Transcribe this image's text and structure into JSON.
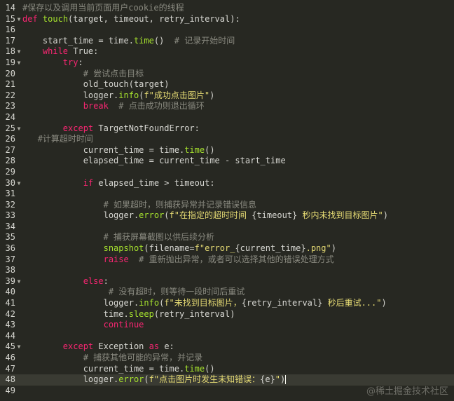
{
  "editor": {
    "lines": [
      {
        "num": "14",
        "fold": "",
        "current": false,
        "tokens": [
          {
            "t": "#保存以及调用当前页面用户cookie的线程",
            "c": "cm"
          }
        ]
      },
      {
        "num": "15",
        "fold": "▼",
        "current": false,
        "tokens": [
          {
            "t": "def",
            "c": "kw"
          },
          {
            "t": " ",
            "c": "pl"
          },
          {
            "t": "touch",
            "c": "fn"
          },
          {
            "t": "(target, timeout, retry_interval):",
            "c": "pl"
          }
        ]
      },
      {
        "num": "16",
        "fold": "",
        "current": false,
        "tokens": []
      },
      {
        "num": "17",
        "fold": "",
        "current": false,
        "tokens": [
          {
            "t": "    start_time = time.",
            "c": "pl"
          },
          {
            "t": "time",
            "c": "fn"
          },
          {
            "t": "()  ",
            "c": "pl"
          },
          {
            "t": "# 记录开始时间",
            "c": "cm"
          }
        ]
      },
      {
        "num": "18",
        "fold": "▼",
        "current": false,
        "tokens": [
          {
            "t": "    ",
            "c": "pl"
          },
          {
            "t": "while",
            "c": "kw"
          },
          {
            "t": " True:",
            "c": "pl"
          }
        ]
      },
      {
        "num": "19",
        "fold": "▼",
        "current": false,
        "tokens": [
          {
            "t": "        ",
            "c": "pl"
          },
          {
            "t": "try",
            "c": "kw"
          },
          {
            "t": ":",
            "c": "pl"
          }
        ]
      },
      {
        "num": "20",
        "fold": "",
        "current": false,
        "tokens": [
          {
            "t": "            ",
            "c": "pl"
          },
          {
            "t": "# 尝试点击目标",
            "c": "cm"
          }
        ]
      },
      {
        "num": "21",
        "fold": "",
        "current": false,
        "tokens": [
          {
            "t": "            old_touch(target)",
            "c": "pl"
          }
        ]
      },
      {
        "num": "22",
        "fold": "",
        "current": false,
        "tokens": [
          {
            "t": "            logger.",
            "c": "pl"
          },
          {
            "t": "info",
            "c": "fn"
          },
          {
            "t": "(",
            "c": "pl"
          },
          {
            "t": "f\"成功点击图片\"",
            "c": "str"
          },
          {
            "t": ")",
            "c": "pl"
          }
        ]
      },
      {
        "num": "23",
        "fold": "",
        "current": false,
        "tokens": [
          {
            "t": "            ",
            "c": "pl"
          },
          {
            "t": "break",
            "c": "kw"
          },
          {
            "t": "  ",
            "c": "pl"
          },
          {
            "t": "# 点击成功则退出循环",
            "c": "cm"
          }
        ]
      },
      {
        "num": "24",
        "fold": "",
        "current": false,
        "tokens": []
      },
      {
        "num": "25",
        "fold": "▼",
        "current": false,
        "tokens": [
          {
            "t": "        ",
            "c": "pl"
          },
          {
            "t": "except",
            "c": "kw"
          },
          {
            "t": " TargetNotFoundError:",
            "c": "pl"
          }
        ]
      },
      {
        "num": "26",
        "fold": "",
        "current": false,
        "tokens": [
          {
            "t": "   ",
            "c": "pl"
          },
          {
            "t": "#计算超时时间",
            "c": "cm"
          }
        ]
      },
      {
        "num": "27",
        "fold": "",
        "current": false,
        "tokens": [
          {
            "t": "            current_time = time.",
            "c": "pl"
          },
          {
            "t": "time",
            "c": "fn"
          },
          {
            "t": "()",
            "c": "pl"
          }
        ]
      },
      {
        "num": "28",
        "fold": "",
        "current": false,
        "tokens": [
          {
            "t": "            elapsed_time = current_time - start_time",
            "c": "pl"
          }
        ]
      },
      {
        "num": "29",
        "fold": "",
        "current": false,
        "tokens": []
      },
      {
        "num": "30",
        "fold": "▼",
        "current": false,
        "tokens": [
          {
            "t": "            ",
            "c": "pl"
          },
          {
            "t": "if",
            "c": "kw"
          },
          {
            "t": " elapsed_time > timeout:",
            "c": "pl"
          }
        ]
      },
      {
        "num": "31",
        "fold": "",
        "current": false,
        "tokens": []
      },
      {
        "num": "32",
        "fold": "",
        "current": false,
        "tokens": [
          {
            "t": "                ",
            "c": "pl"
          },
          {
            "t": "# 如果超时，则捕获异常并记录错误信息",
            "c": "cm"
          }
        ]
      },
      {
        "num": "33",
        "fold": "",
        "current": false,
        "tokens": [
          {
            "t": "                logger.",
            "c": "pl"
          },
          {
            "t": "error",
            "c": "fn"
          },
          {
            "t": "(",
            "c": "pl"
          },
          {
            "t": "f\"在指定的超时时间 ",
            "c": "str"
          },
          {
            "t": "{timeout}",
            "c": "pl"
          },
          {
            "t": " 秒内未找到目标图片\"",
            "c": "str"
          },
          {
            "t": ")",
            "c": "pl"
          }
        ]
      },
      {
        "num": "34",
        "fold": "",
        "current": false,
        "tokens": []
      },
      {
        "num": "35",
        "fold": "",
        "current": false,
        "tokens": [
          {
            "t": "                ",
            "c": "pl"
          },
          {
            "t": "# 捕获屏幕截图以供后续分析",
            "c": "cm"
          }
        ]
      },
      {
        "num": "36",
        "fold": "",
        "current": false,
        "tokens": [
          {
            "t": "                ",
            "c": "pl"
          },
          {
            "t": "snapshot",
            "c": "fn"
          },
          {
            "t": "(filename=",
            "c": "pl"
          },
          {
            "t": "f\"error_",
            "c": "str"
          },
          {
            "t": "{current_time}",
            "c": "pl"
          },
          {
            "t": ".png\"",
            "c": "str"
          },
          {
            "t": ")",
            "c": "pl"
          }
        ]
      },
      {
        "num": "37",
        "fold": "",
        "current": false,
        "tokens": [
          {
            "t": "                ",
            "c": "pl"
          },
          {
            "t": "raise",
            "c": "kw"
          },
          {
            "t": "  ",
            "c": "pl"
          },
          {
            "t": "# 重新抛出异常，或者可以选择其他的错误处理方式",
            "c": "cm"
          }
        ]
      },
      {
        "num": "38",
        "fold": "",
        "current": false,
        "tokens": []
      },
      {
        "num": "39",
        "fold": "▼",
        "current": false,
        "tokens": [
          {
            "t": "            ",
            "c": "pl"
          },
          {
            "t": "else",
            "c": "kw"
          },
          {
            "t": ":",
            "c": "pl"
          }
        ]
      },
      {
        "num": "40",
        "fold": "",
        "current": false,
        "tokens": [
          {
            "t": "                 ",
            "c": "pl"
          },
          {
            "t": "# 没有超时，则等待一段时间后重试",
            "c": "cm"
          }
        ]
      },
      {
        "num": "41",
        "fold": "",
        "current": false,
        "tokens": [
          {
            "t": "                logger.",
            "c": "pl"
          },
          {
            "t": "info",
            "c": "fn"
          },
          {
            "t": "(",
            "c": "pl"
          },
          {
            "t": "f\"未找到目标图片，",
            "c": "str"
          },
          {
            "t": "{retry_interval}",
            "c": "pl"
          },
          {
            "t": " 秒后重试...\"",
            "c": "str"
          },
          {
            "t": ")",
            "c": "pl"
          }
        ]
      },
      {
        "num": "42",
        "fold": "",
        "current": false,
        "tokens": [
          {
            "t": "                time.",
            "c": "pl"
          },
          {
            "t": "sleep",
            "c": "fn"
          },
          {
            "t": "(retry_interval)",
            "c": "pl"
          }
        ]
      },
      {
        "num": "43",
        "fold": "",
        "current": false,
        "tokens": [
          {
            "t": "                ",
            "c": "pl"
          },
          {
            "t": "continue",
            "c": "kw"
          }
        ]
      },
      {
        "num": "44",
        "fold": "",
        "current": false,
        "tokens": []
      },
      {
        "num": "45",
        "fold": "▼",
        "current": false,
        "tokens": [
          {
            "t": "        ",
            "c": "pl"
          },
          {
            "t": "except",
            "c": "kw"
          },
          {
            "t": " Exception ",
            "c": "pl"
          },
          {
            "t": "as",
            "c": "kw"
          },
          {
            "t": " e:",
            "c": "pl"
          }
        ]
      },
      {
        "num": "46",
        "fold": "",
        "current": false,
        "tokens": [
          {
            "t": "            ",
            "c": "pl"
          },
          {
            "t": "# 捕获其他可能的异常，并记录",
            "c": "cm"
          }
        ]
      },
      {
        "num": "47",
        "fold": "",
        "current": false,
        "tokens": [
          {
            "t": "            current_time = time.",
            "c": "pl"
          },
          {
            "t": "time",
            "c": "fn"
          },
          {
            "t": "()",
            "c": "pl"
          }
        ]
      },
      {
        "num": "48",
        "fold": "",
        "current": true,
        "tokens": [
          {
            "t": "            logger.",
            "c": "pl"
          },
          {
            "t": "error",
            "c": "fn"
          },
          {
            "t": "(",
            "c": "pl"
          },
          {
            "t": "f\"点击图片时发生未知错误：",
            "c": "str"
          },
          {
            "t": "{e}",
            "c": "pl"
          },
          {
            "t": "\"",
            "c": "str"
          },
          {
            "t": ")",
            "c": "pl"
          }
        ]
      },
      {
        "num": "49",
        "fold": "",
        "current": false,
        "tokens": []
      }
    ]
  },
  "watermark": "@稀土掘金技术社区",
  "colors": {
    "background": "#272822",
    "current_line": "#3a3b33",
    "keyword": "#f92672",
    "function": "#a6e22e",
    "string": "#e6db74",
    "comment": "#8a8a80",
    "plain": "#d7d7d2",
    "line_number": "#d8d8d2"
  },
  "icons": {
    "fold_marker": "chevron-down-icon"
  }
}
